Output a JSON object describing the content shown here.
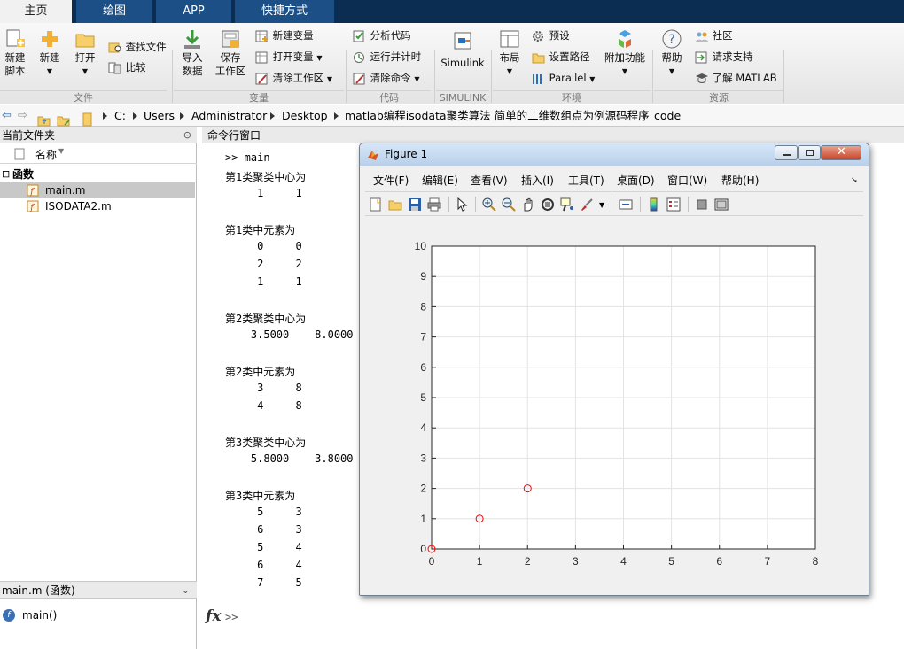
{
  "tabs": [
    "主页",
    "绘图",
    "APP",
    "快捷方式"
  ],
  "ribbon": {
    "new_script": [
      "新建",
      "脚本"
    ],
    "new": "新建",
    "open": "打开",
    "find_files": "查找文件",
    "compare": "比较",
    "import": [
      "导入",
      "数据"
    ],
    "save_ws": [
      "保存",
      "工作区"
    ],
    "new_var": "新建变量",
    "open_var": "打开变量",
    "clear_ws": "清除工作区",
    "analyze": "分析代码",
    "run_time": "运行并计时",
    "clear_cmd": "清除命令",
    "simulink": "Simulink",
    "layout": "布局",
    "prefs": "预设",
    "set_path": "设置路径",
    "parallel": "Parallel",
    "addons": "附加功能",
    "help": "帮助",
    "community": "社区",
    "support": "请求支持",
    "learn": "了解 MATLAB",
    "groups": {
      "file": "文件",
      "variable": "变量",
      "code": "代码",
      "simulink": "SIMULINK",
      "env": "环境",
      "resources": "资源"
    }
  },
  "address": [
    "C:",
    "Users",
    "Administrator",
    "Desktop",
    "matlab编程isodata聚类算法 简单的二维数组点为例源码程序",
    "code"
  ],
  "current_folder": {
    "title": "当前文件夹",
    "col_name": "名称",
    "group": "函数",
    "files": [
      "main.m",
      "ISODATA2.m"
    ]
  },
  "details": {
    "title": "main.m  (函数)",
    "item": "main()"
  },
  "command": {
    "title": "命令行窗口",
    "lines": [
      ">> main",
      "第1类聚类中心为",
      "     1     1",
      "",
      "第1类中元素为",
      "     0     0",
      "     2     2",
      "     1     1",
      "",
      "第2类聚类中心为",
      "    3.5000    8.0000",
      "",
      "第2类中元素为",
      "     3     8",
      "     4     8",
      "",
      "第3类聚类中心为",
      "    5.8000    3.8000",
      "",
      "第3类中元素为",
      "     5     3",
      "     6     3",
      "     5     4",
      "     6     4",
      "     7     5"
    ],
    "prompt": ">>",
    "fx": "fx"
  },
  "figure": {
    "title": "Figure 1",
    "menu": [
      "文件(F)",
      "编辑(E)",
      "查看(V)",
      "插入(I)",
      "工具(T)",
      "桌面(D)",
      "窗口(W)",
      "帮助(H)"
    ]
  },
  "chart_data": {
    "type": "scatter",
    "title": "",
    "xlabel": "",
    "ylabel": "",
    "xlim": [
      0,
      8
    ],
    "ylim": [
      0,
      10
    ],
    "xticks": [
      0,
      1,
      2,
      3,
      4,
      5,
      6,
      7,
      8
    ],
    "yticks": [
      0,
      1,
      2,
      3,
      4,
      5,
      6,
      7,
      8,
      9,
      10
    ],
    "grid": true,
    "marker": "circle",
    "color": "#ff0000",
    "points": [
      {
        "x": 0,
        "y": 0
      },
      {
        "x": 1,
        "y": 1
      },
      {
        "x": 2,
        "y": 2
      }
    ]
  }
}
